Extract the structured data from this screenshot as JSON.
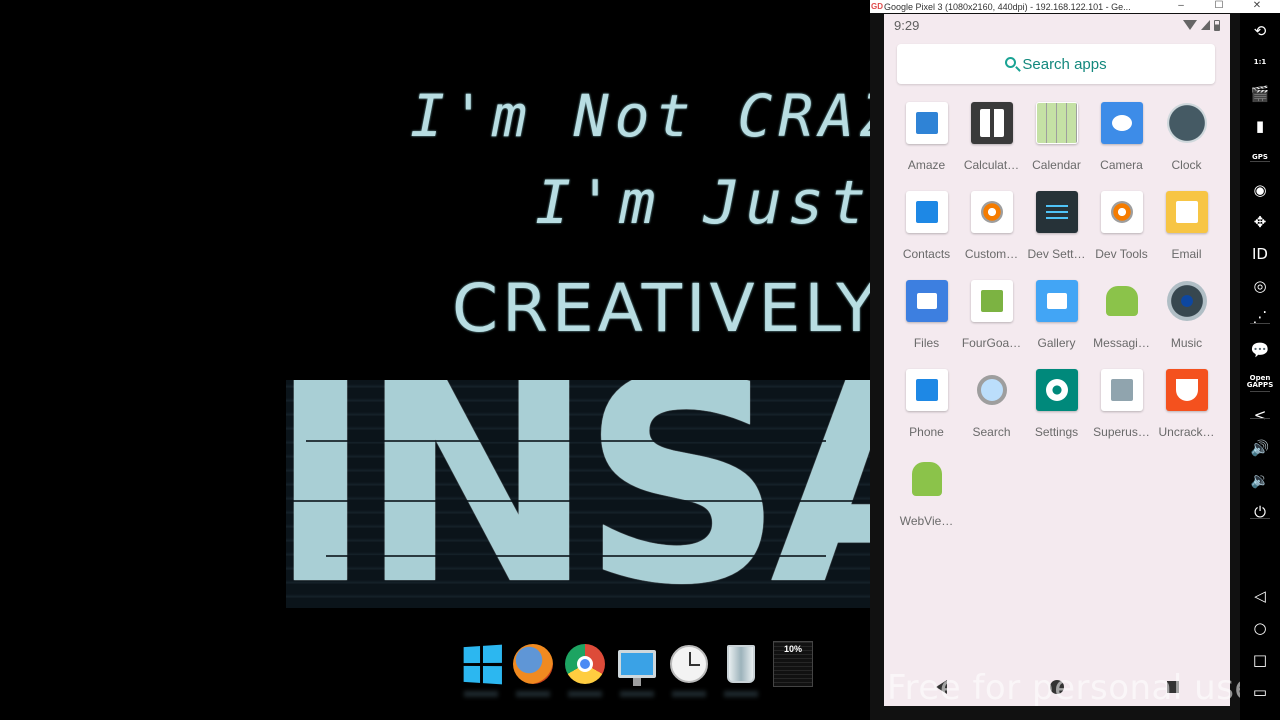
{
  "desktop": {
    "wallpaper": {
      "line1": "I'm Not CRAZY",
      "line2": "I'm Just",
      "line3": "CREATIVELY",
      "line4": "INSANE"
    },
    "dock": [
      {
        "name": "windows-start-icon"
      },
      {
        "name": "firefox-icon"
      },
      {
        "name": "chrome-icon"
      },
      {
        "name": "computer-icon"
      },
      {
        "name": "clock-icon"
      },
      {
        "name": "recycle-bin-icon"
      },
      {
        "name": "cpu-meter-icon",
        "text": "10%"
      }
    ]
  },
  "emulator": {
    "title": "Google Pixel 3 (1080x2160, 440dpi) - 192.168.122.101 - Ge...",
    "window_controls": {
      "minimize": "–",
      "maximize": "☐",
      "close": "✕"
    },
    "status_bar": {
      "time": "9:29"
    },
    "search": {
      "placeholder": "Search apps"
    },
    "apps": [
      {
        "label": "Amaze",
        "icon": "folder-search-icon",
        "color": "#2f83d6"
      },
      {
        "label": "Calculat…",
        "icon": "calculator-icon",
        "color": "#3a3a3a"
      },
      {
        "label": "Calendar",
        "icon": "calendar-icon",
        "color": "#9ccc65"
      },
      {
        "label": "Camera",
        "icon": "camera-icon",
        "color": "#3d8ce8"
      },
      {
        "label": "Clock",
        "icon": "clock-icon",
        "color": "#37474f"
      },
      {
        "label": "Contacts",
        "icon": "contacts-icon",
        "color": "#1e88e5"
      },
      {
        "label": "Custom…",
        "icon": "settings-gear-icon",
        "color": "#f57c00"
      },
      {
        "label": "Dev Sett…",
        "icon": "dev-settings-icon",
        "color": "#263238"
      },
      {
        "label": "Dev Tools",
        "icon": "settings-gear-icon",
        "color": "#f57c00"
      },
      {
        "label": "Email",
        "icon": "email-icon",
        "color": "#f7c544"
      },
      {
        "label": "Files",
        "icon": "folder-icon",
        "color": "#3d7fe0"
      },
      {
        "label": "FourGoa…",
        "icon": "android-notepad-icon",
        "color": "#7cb342"
      },
      {
        "label": "Gallery",
        "icon": "gallery-icon",
        "color": "#42a5f5"
      },
      {
        "label": "Messagi…",
        "icon": "messaging-icon",
        "color": "#8bc34a"
      },
      {
        "label": "Music",
        "icon": "speaker-icon",
        "color": "#1a237e"
      },
      {
        "label": "Phone",
        "icon": "phone-icon",
        "color": "#1e88e5"
      },
      {
        "label": "Search",
        "icon": "magnifier-icon",
        "color": "#90caf9"
      },
      {
        "label": "Settings",
        "icon": "gear-icon",
        "color": "#00897b"
      },
      {
        "label": "Superus…",
        "icon": "superuser-icon",
        "color": "#90a4ae"
      },
      {
        "label": "Uncrack…",
        "icon": "uncrackable-icon",
        "color": "#f4511e"
      },
      {
        "label": "WebVie…",
        "icon": "android-robot-icon",
        "color": "#8bc34a"
      }
    ],
    "watermark": "Free for personal use"
  },
  "sidebar_buttons": [
    {
      "name": "rotate-icon",
      "glyph": "⟲"
    },
    {
      "name": "pixel-perfect-icon",
      "glyph": "1:1"
    },
    {
      "name": "screen-record-icon",
      "glyph": "🎬"
    },
    {
      "name": "battery-icon",
      "glyph": "▮"
    },
    {
      "name": "gps-icon",
      "glyph": "GPS"
    },
    {
      "name": "webcam-icon",
      "glyph": "◉"
    },
    {
      "name": "dpad-icon",
      "glyph": "✥"
    },
    {
      "name": "identifiers-icon",
      "glyph": "ID"
    },
    {
      "name": "media-icon",
      "glyph": "◎"
    },
    {
      "name": "network-icon",
      "glyph": "⋰"
    },
    {
      "name": "sms-icon",
      "glyph": "💬"
    },
    {
      "name": "open-gapps-icon",
      "glyph": "Open GAPPS"
    },
    {
      "name": "share-icon",
      "glyph": "<"
    },
    {
      "name": "volume-up-icon",
      "glyph": "🔊"
    },
    {
      "name": "volume-down-icon",
      "glyph": "🔉"
    },
    {
      "name": "power-icon",
      "glyph": "⏻"
    },
    {
      "name": "back-icon",
      "glyph": "◁"
    },
    {
      "name": "home-icon",
      "glyph": "○"
    },
    {
      "name": "recents-icon",
      "glyph": "□"
    },
    {
      "name": "menu-icon",
      "glyph": "▭"
    }
  ]
}
